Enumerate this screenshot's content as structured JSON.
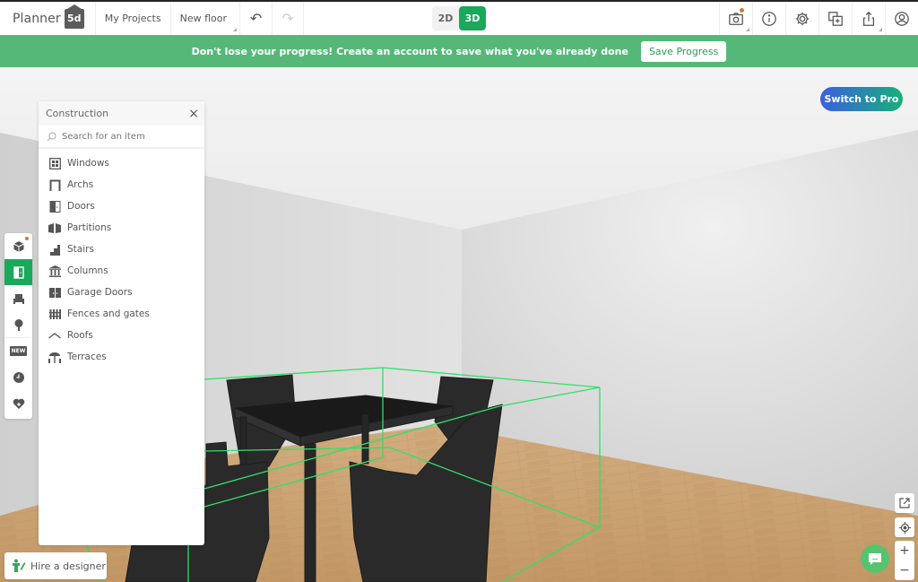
{
  "header": {
    "logo_text": "Planner",
    "logo_badge": "5d",
    "my_projects": "My Projects",
    "floor_selector": "New floor",
    "undo_icon": "↶",
    "redo_icon": "↷",
    "view_toggle": {
      "option_2d": "2D",
      "option_3d": "3D",
      "selected": "3D"
    },
    "right_icons": [
      "camera-icon",
      "info-icon",
      "gear-icon",
      "add-layer-icon",
      "share-icon",
      "user-icon"
    ]
  },
  "banner": {
    "message": "Don't lose your progress! Create an account to save what you've already done",
    "button_label": "Save Progress",
    "color": "#56b878"
  },
  "pro_button": {
    "label": "Switch to Pro"
  },
  "left_toolbar": {
    "items": [
      "3d-model-icon",
      "construction-door-icon",
      "furniture-icon",
      "exterior-tree-icon",
      "new-icon",
      "history-icon",
      "favorites-icon"
    ],
    "active": "construction-door-icon",
    "new_badge": "NEW"
  },
  "panel": {
    "title": "Construction",
    "close_icon": "×",
    "search_placeholder": "Search for an item",
    "items": [
      {
        "label": "Windows",
        "icon": "window-icon"
      },
      {
        "label": "Archs",
        "icon": "arch-icon"
      },
      {
        "label": "Doors",
        "icon": "door-icon"
      },
      {
        "label": "Partitions",
        "icon": "partition-icon"
      },
      {
        "label": "Stairs",
        "icon": "stairs-icon"
      },
      {
        "label": "Columns",
        "icon": "columns-icon"
      },
      {
        "label": "Garage Doors",
        "icon": "garage-door-icon"
      },
      {
        "label": "Fences and gates",
        "icon": "fence-icon"
      },
      {
        "label": "Roofs",
        "icon": "roof-icon"
      },
      {
        "label": "Terraces",
        "icon": "terrace-icon"
      }
    ]
  },
  "hire_designer": {
    "label": "Hire a designer"
  },
  "view_controls": {
    "zoom_in": "+",
    "zoom_out": "−"
  },
  "colors": {
    "accent": "#1aa85a",
    "selection_box": "#2ee06a",
    "floor": "#c9a072"
  }
}
